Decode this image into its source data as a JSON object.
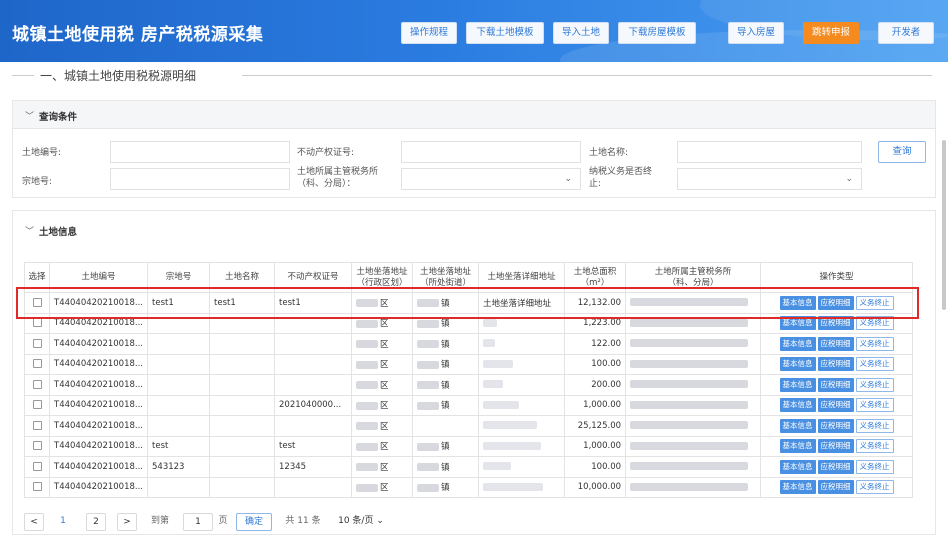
{
  "header": {
    "title": "城镇土地使用税 房产税税源采集",
    "buttons": [
      {
        "label": "操作规程",
        "style": "light"
      },
      {
        "label": "下载土地模板",
        "style": "light"
      },
      {
        "label": "导入土地",
        "style": "light"
      },
      {
        "label": "下载房屋模板",
        "style": "light"
      },
      {
        "label": "导入房屋",
        "style": "light"
      },
      {
        "label": "跳转申报",
        "style": "orange"
      },
      {
        "label": "开发者",
        "style": "light"
      }
    ]
  },
  "section_title": "一、城镇土地使用税税源明细",
  "query": {
    "panel_title": "查询条件",
    "land_no_label": "土地编号:",
    "property_cert_label": "不动产权证号:",
    "land_name_label": "土地名称:",
    "query_button": "查询",
    "parcel_no_label": "宗地号:",
    "tax_office_label": "土地所属主管税务所\n（科、分局）：",
    "obligation_label": "纳税义务是否终\n止:"
  },
  "land_info": {
    "panel_title": "土地信息",
    "columns": [
      "选择",
      "土地编号",
      "宗地号",
      "土地名称",
      "不动产权证号",
      "土地坐落地址\n（行政区划）",
      "土地坐落地址\n（所处街道）",
      "土地坐落详细地址",
      "土地总面积\n（m²）",
      "土地所属主管税务所\n（科、分局）",
      "操作类型"
    ],
    "rows": [
      {
        "land_no": "T44040420210018...",
        "parcel": "test1",
        "name": "test1",
        "cert": "test1",
        "district": "区",
        "street": "镇",
        "address": "土地坐落详细地址",
        "area": "12,132.00"
      },
      {
        "land_no": "T44040420210018...",
        "parcel": "",
        "name": "",
        "cert": "",
        "district": "区",
        "street": "镇",
        "address": "",
        "area": "1,223.00"
      },
      {
        "land_no": "T44040420210018...",
        "parcel": "",
        "name": "",
        "cert": "",
        "district": "区",
        "street": "镇",
        "address": "",
        "area": "122.00"
      },
      {
        "land_no": "T44040420210018...",
        "parcel": "",
        "name": "",
        "cert": "",
        "district": "区",
        "street": "镇",
        "address": "",
        "area": "100.00"
      },
      {
        "land_no": "T44040420210018...",
        "parcel": "",
        "name": "",
        "cert": "",
        "district": "区",
        "street": "镇",
        "address": "",
        "area": "200.00"
      },
      {
        "land_no": "T44040420210018...",
        "parcel": "",
        "name": "",
        "cert": "2021040000...",
        "district": "区",
        "street": "镇",
        "address": "",
        "area": "1,000.00"
      },
      {
        "land_no": "T44040420210018...",
        "parcel": "",
        "name": "",
        "cert": "",
        "district": "区",
        "street": "",
        "address": "",
        "area": "25,125.00"
      },
      {
        "land_no": "T44040420210018...",
        "parcel": "test",
        "name": "",
        "cert": "test",
        "district": "区",
        "street": "镇",
        "address": "",
        "area": "1,000.00"
      },
      {
        "land_no": "T44040420210018...",
        "parcel": "543123",
        "name": "",
        "cert": "12345",
        "district": "区",
        "street": "镇",
        "address": "",
        "area": "100.00"
      },
      {
        "land_no": "T44040420210018...",
        "parcel": "",
        "name": "",
        "cert": "",
        "district": "区",
        "street": "镇",
        "address": "",
        "area": "10,000.00"
      }
    ],
    "row_actions": [
      "基本信息",
      "应税明细",
      "义务终止"
    ]
  },
  "pagination": {
    "prev": "<",
    "page1": "1",
    "page2": "2",
    "next": ">",
    "goto_label": "到第",
    "goto_value": "1",
    "page_unit": "页",
    "confirm": "确定",
    "total": "共 11 条",
    "page_size": "10 条/页"
  },
  "colors": {
    "brand": "#2a7be0",
    "accent_orange": "#f58a1f",
    "highlight": "#e02a2a"
  }
}
